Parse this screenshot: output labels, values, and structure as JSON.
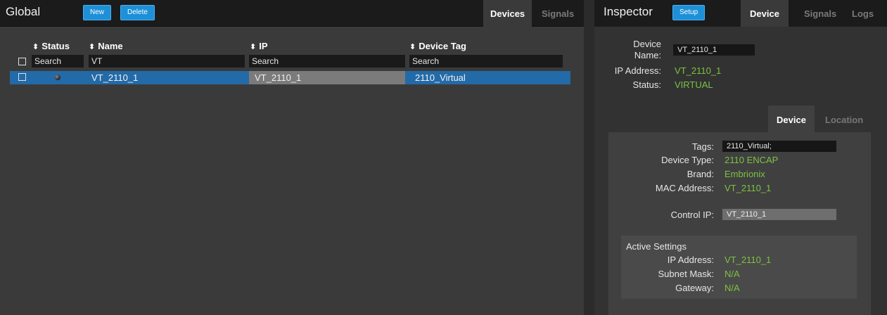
{
  "left": {
    "title": "Global",
    "new_label": "New",
    "delete_label": "Delete",
    "tabs": [
      "Devices",
      "Signals"
    ],
    "columns": [
      "Status",
      "Name",
      "IP",
      "Device Tag"
    ],
    "filters": {
      "status": "Search",
      "name": "VT",
      "ip": "Search",
      "tag": "Search"
    },
    "rows": [
      {
        "name": "VT_2110_1",
        "ip": "VT_2110_1",
        "tag": "2110_Virtual"
      }
    ]
  },
  "inspector": {
    "title": "Inspector",
    "setup_label": "Setup",
    "tabs": [
      "Device",
      "Signals",
      "Logs"
    ],
    "device_name_label": "Device Name:",
    "device_name_value": "VT_2110_1",
    "ip_label": "IP Address:",
    "ip_value": "VT_2110_1",
    "status_label": "Status:",
    "status_value": "VIRTUAL",
    "sub_tabs": [
      "Device",
      "Location"
    ],
    "tags_label": "Tags:",
    "tags_value": "2110_Virtual;",
    "device_type_label": "Device Type:",
    "device_type_value": "2110 ENCAP",
    "brand_label": "Brand:",
    "brand_value": "Embrionix",
    "mac_label": "MAC Address:",
    "mac_value": "VT_2110_1",
    "control_ip_label": "Control IP:",
    "control_ip_value": "VT_2110_1",
    "active_settings": {
      "title": "Active Settings",
      "ip_label": "IP Address:",
      "ip_value": "VT_2110_1",
      "subnet_label": "Subnet Mask:",
      "subnet_value": "N/A",
      "gateway_label": "Gateway:",
      "gateway_value": "N/A"
    }
  },
  "colors": {
    "accent_blue": "#1e90d8",
    "selected_row": "#236aa8",
    "value_green": "#7cc242"
  }
}
